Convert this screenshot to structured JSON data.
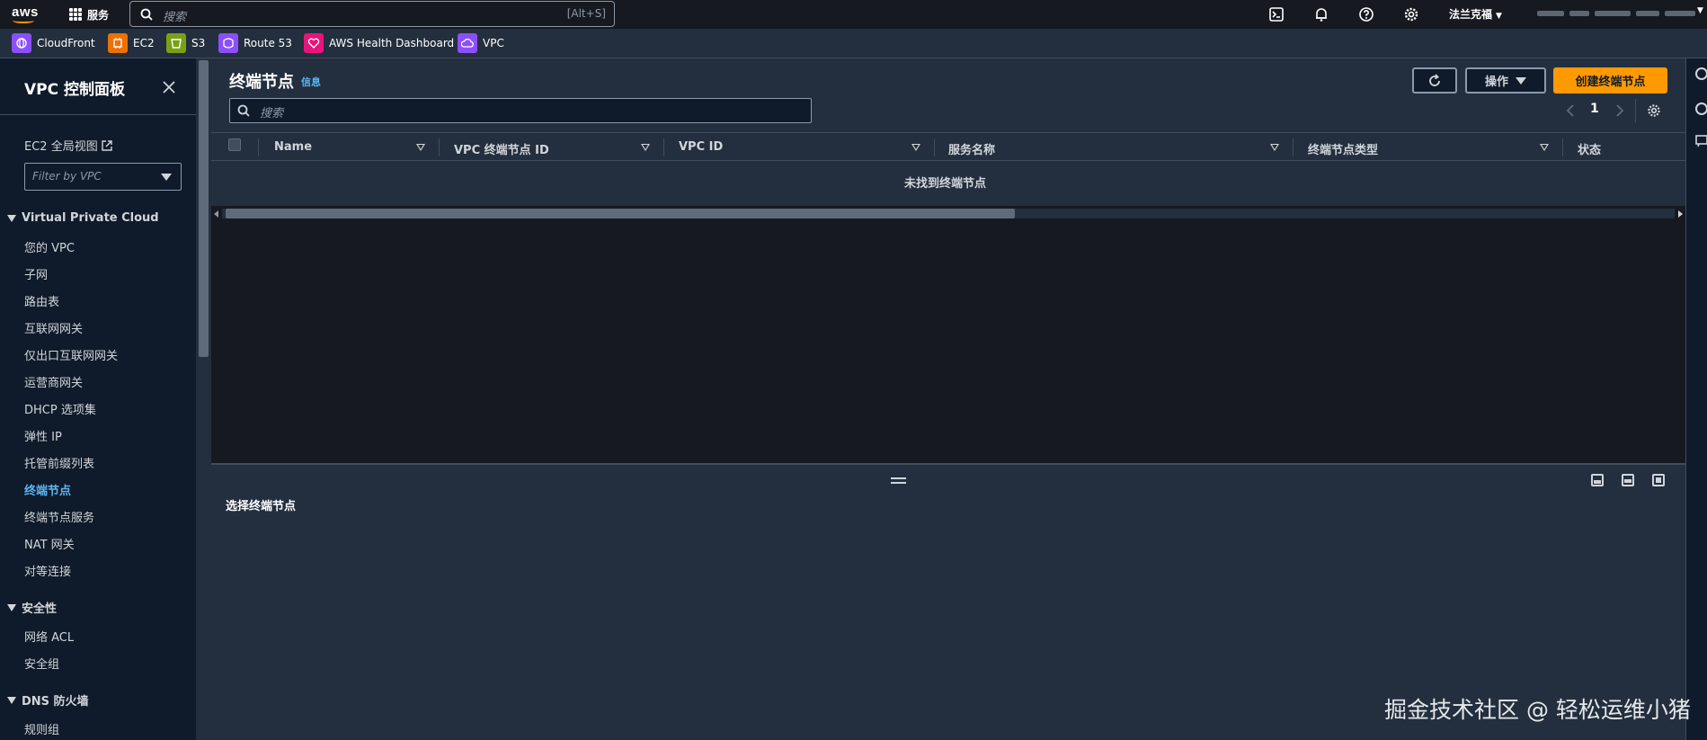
{
  "topnav": {
    "logo_text": "aws",
    "services_label": "服务",
    "search_placeholder": "搜索",
    "search_shortcut": "[Alt+S]",
    "region": "法兰克福",
    "icons": [
      "cloudshell-icon",
      "bell-icon",
      "help-icon",
      "gear-icon"
    ]
  },
  "favorites": [
    {
      "label": "CloudFront",
      "color": "#8c4fff"
    },
    {
      "label": "EC2",
      "color": "#ed7100"
    },
    {
      "label": "S3",
      "color": "#7aa116"
    },
    {
      "label": "Route 53",
      "color": "#8c4fff"
    },
    {
      "label": "AWS Health Dashboard",
      "color": "#e7157b"
    },
    {
      "label": "VPC",
      "color": "#8c4fff"
    }
  ],
  "sidebar": {
    "title": "VPC 控制面板",
    "global_view": "EC2 全局视图",
    "filter_placeholder": "Filter by VPC",
    "sections": [
      {
        "title": "Virtual Private Cloud",
        "items": [
          "您的 VPC",
          "子网",
          "路由表",
          "互联网网关",
          "仅出口互联网网关",
          "运营商网关",
          "DHCP 选项集",
          "弹性 IP",
          "托管前缀列表",
          "终端节点",
          "终端节点服务",
          "NAT 网关",
          "对等连接"
        ]
      },
      {
        "title": "安全性",
        "items": [
          "网络 ACL",
          "安全组"
        ]
      },
      {
        "title": "DNS 防火墙",
        "items": [
          "规则组"
        ]
      }
    ],
    "active_item": "终端节点"
  },
  "main": {
    "title": "终端节点",
    "info_link": "信息",
    "actions_label": "操作",
    "create_label": "创建终端节点",
    "search_placeholder": "搜索",
    "page_number": "1",
    "columns": [
      "Name",
      "VPC 终端节点 ID",
      "VPC ID",
      "服务名称",
      "终端节点类型",
      "状态"
    ],
    "empty_message": "未找到终端节点"
  },
  "split_panel": {
    "title": "选择终端节点"
  },
  "watermark": "掘金技术社区 @ 轻松运维小猪",
  "colors": {
    "accent": "#ff9900",
    "link": "#5ab6f5",
    "nav_bg": "#16191f",
    "panel_bg": "#232f3e"
  }
}
